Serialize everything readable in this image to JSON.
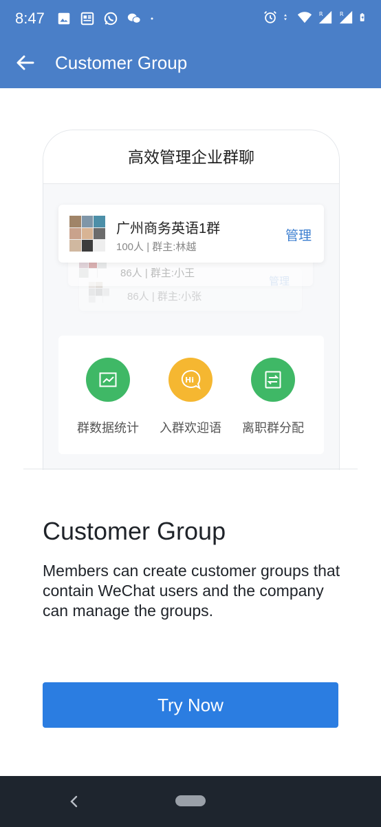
{
  "status_bar": {
    "time": "8:47",
    "left_icons": [
      "image-icon",
      "news-icon",
      "whatsapp-icon",
      "wechat-icon",
      "dot-icon"
    ],
    "right_icons": [
      "alarm-icon",
      "data-arrows-icon",
      "wifi-icon",
      "signal-r-icon",
      "signal-r-icon",
      "battery-charging-icon"
    ]
  },
  "app_bar": {
    "title": "Customer Group",
    "back_icon": "arrow-left-icon"
  },
  "illustration": {
    "header": "高效管理企业群聊",
    "groups": [
      {
        "name": "广州商务英语1群",
        "meta": "100人 | 群主:林越",
        "manage": "管理"
      },
      {
        "meta": "86人 | 群主:小王",
        "manage": "管理"
      },
      {
        "meta": "86人 | 群主:小张",
        "manage": "管理"
      }
    ],
    "features": [
      {
        "label": "群数据统计",
        "icon": "chart-icon",
        "color": "#3fb866"
      },
      {
        "label": "入群欢迎语",
        "icon": "hi-chat-icon",
        "color": "#f5b731"
      },
      {
        "label": "离职群分配",
        "icon": "transfer-icon",
        "color": "#3fb866"
      }
    ]
  },
  "content": {
    "title": "Customer Group",
    "description": "Members can create customer groups that contain WeChat users and the company can manage the groups."
  },
  "actions": {
    "try_now": "Try Now"
  },
  "colors": {
    "primary_bar": "#4a7fc8",
    "button": "#2b7de1",
    "nav_bar": "#1e252e"
  }
}
